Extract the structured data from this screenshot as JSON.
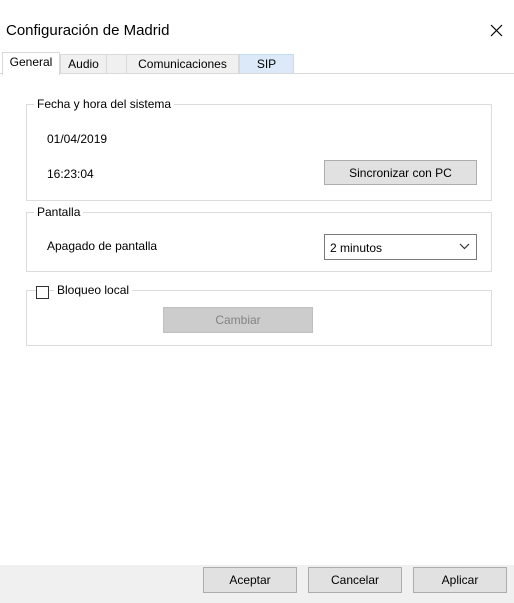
{
  "window": {
    "title": "Configuración de Madrid",
    "close_icon": "close-icon"
  },
  "tabs": [
    {
      "label": "General",
      "selected": true
    },
    {
      "label": "Audio",
      "selected": false
    },
    {
      "label": "Comunicaciones",
      "selected": false
    },
    {
      "label": "SIP",
      "selected": false,
      "highlighted": true
    }
  ],
  "system_datetime": {
    "legend": "Fecha y hora del sistema",
    "date": "01/04/2019",
    "time": "16:23:04",
    "sync_button": "Sincronizar con PC"
  },
  "screen": {
    "legend": "Pantalla",
    "screen_off_label": "Apagado de pantalla",
    "screen_off_value": "2 minutos"
  },
  "local_lock": {
    "label": "Bloqueo local",
    "checked": false,
    "change_button": "Cambiar"
  },
  "footer": {
    "accept": "Aceptar",
    "cancel": "Cancelar",
    "apply": "Aplicar"
  },
  "colors": {
    "tab_highlight": "#dbe9f9",
    "footer_bg": "#f0f0f0",
    "disabled_text": "#838383"
  }
}
